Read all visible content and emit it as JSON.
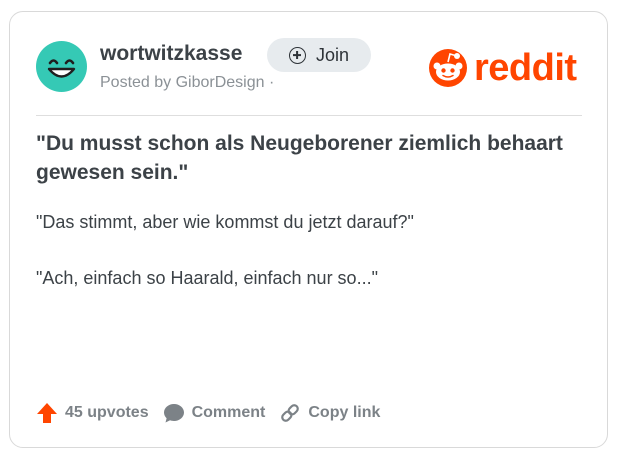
{
  "post": {
    "subreddit": "wortwitzkasse",
    "join_label": "Join",
    "posted_by": "Posted by GiborDesign ·",
    "title": "\"Du musst schon als Neugeborener ziemlich behaart gewesen sein.\"",
    "body": [
      "\"Das stimmt, aber wie kommst du jetzt darauf?\"",
      "\"Ach, einfach so Haarald, einfach nur so...\""
    ]
  },
  "brand": {
    "wordmark": "reddit",
    "color": "#ff4500"
  },
  "actions": {
    "upvotes_label": "45 upvotes",
    "comment_label": "Comment",
    "copy_link_label": "Copy link"
  },
  "colors": {
    "avatar": "#35c9b5",
    "join_bg": "#e7ebee",
    "upvote_arrow": "#ff4500",
    "muted_text": "#7c8287"
  },
  "icons": [
    "smiley-face-icon",
    "plus-circle-icon",
    "reddit-snoo-icon",
    "upvote-arrow-icon",
    "comment-bubble-icon",
    "link-icon"
  ]
}
